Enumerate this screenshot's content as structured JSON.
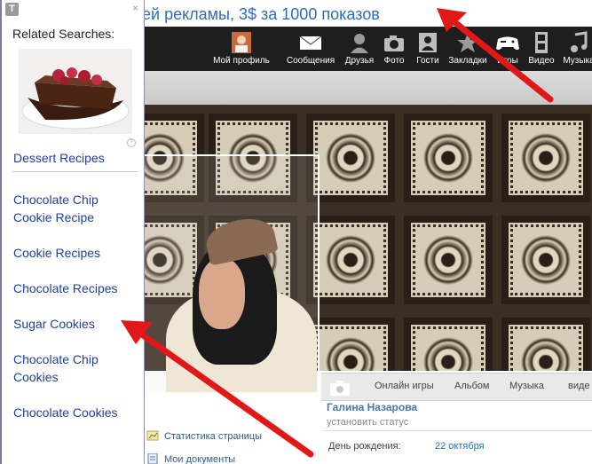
{
  "ad_banner": {
    "text": "ей рекламы, 3$ за 1000 показов"
  },
  "topnav": {
    "items": [
      {
        "label": "Мой профиль",
        "icon": "profile-icon"
      },
      {
        "label": "Сообщения",
        "icon": "envelope-icon"
      },
      {
        "label": "Друзья",
        "icon": "friends-icon"
      },
      {
        "label": "Фото",
        "icon": "camera-icon"
      },
      {
        "label": "Гости",
        "icon": "guests-icon"
      },
      {
        "label": "Закладки",
        "icon": "star-icon"
      },
      {
        "label": "Игры",
        "icon": "gamepad-icon"
      },
      {
        "label": "Видео",
        "icon": "film-icon"
      },
      {
        "label": "Музыка",
        "icon": "music-icon"
      }
    ]
  },
  "profile": {
    "tabs": [
      "Онлайн игры",
      "Альбом",
      "Музыка",
      "виде"
    ],
    "name": "Галина Назарова",
    "status_link": "установить статус",
    "birthday_label": "День рождения:",
    "birthday_value": "22 октября",
    "left_links": [
      "Статистика страницы",
      "Мои документы"
    ]
  },
  "panel": {
    "logo": "T",
    "close": "×",
    "title": "Related Searches:",
    "help": "?",
    "items": [
      "Dessert Recipes",
      "Chocolate Chip Cookie Recipe",
      "Cookie Recipes",
      "Chocolate Recipes",
      "Sugar Cookies",
      "Chocolate Chip Cookies",
      "Chocolate Cookies"
    ]
  },
  "colors": {
    "ad_text": "#2e6db5",
    "nav_bg": "#1e1e1e",
    "link": "#1f3f9c",
    "arrow": "#e01818"
  }
}
